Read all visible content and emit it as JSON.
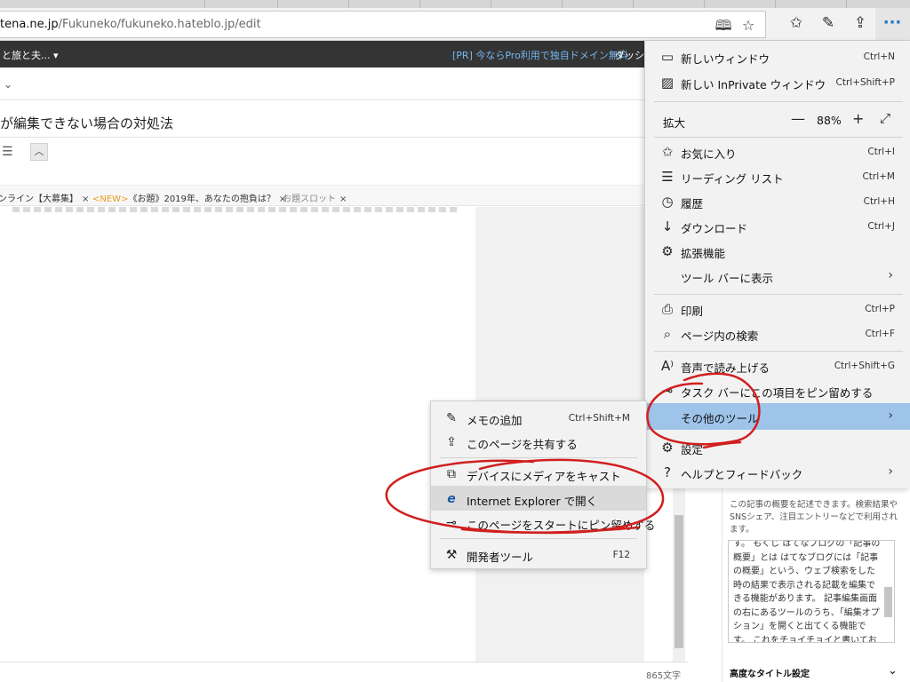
{
  "browser": {
    "url_prefix": "tena.ne.jp",
    "url_rest": "/Fukuneko/fukuneko.hateblo.jp/edit",
    "icons": [
      "reading-view-icon",
      "favorite-star-icon",
      "favorites-hub-icon",
      "pen-notes-icon",
      "share-icon",
      "more-dots-icon"
    ],
    "more_label": "···"
  },
  "page": {
    "blog_name": "と旅と夫... ▾",
    "pr_text": "[PR] 今ならPro利用で独自ドメイン無料",
    "dashboard": "ダッシュ",
    "title": "が編集できない場合の対処法",
    "tags": [
      {
        "prefix": "",
        "label": "ンライン【大募集】",
        "close": "×"
      },
      {
        "prefix": "<NEW>",
        "label": "《お題》2019年、あなたの抱負は？",
        "close": "×"
      },
      {
        "prefix": "",
        "label": "お題スロット",
        "close": "×"
      }
    ],
    "char_count": "865文字",
    "side_panel": {
      "description": "この記事の概要を記述できます。検索結果やSNSシェア、注目エントリーなどで利用されます。",
      "summary_text": "す。 もくじ はてなブログの「記事の概要」とは はてなブログには「記事の概要」という、ウェブ検索をした時の結果で表示される記載を編集できる機能があります。 記事編集画面の右にあるツールのうち、「編集オプション」を開くと出てくる機能です。 これをチョイチョイと書いてお",
      "advanced_label": "高度なタイトル設定"
    }
  },
  "menu": {
    "items_top": [
      {
        "icon": "new-window-icon",
        "label": "新しいウィンドウ",
        "shortcut": "Ctrl+N"
      },
      {
        "icon": "inprivate-window-icon",
        "label": "新しい InPrivate ウィンドウ",
        "shortcut": "Ctrl+Shift+P"
      }
    ],
    "zoom": {
      "label": "拡大",
      "value": "88%",
      "minus": "—",
      "plus": "+",
      "fullscreen": "⤢"
    },
    "items_mid": [
      {
        "icon": "favorites-icon",
        "label": "お気に入り",
        "shortcut": "Ctrl+I"
      },
      {
        "icon": "reading-list-icon",
        "label": "リーディング リスト",
        "shortcut": "Ctrl+M"
      },
      {
        "icon": "history-icon",
        "label": "履歴",
        "shortcut": "Ctrl+H"
      },
      {
        "icon": "download-icon",
        "label": "ダウンロード",
        "shortcut": "Ctrl+J"
      },
      {
        "icon": "extensions-icon",
        "label": "拡張機能",
        "shortcut": ""
      },
      {
        "icon": "",
        "label": "ツール バーに表示",
        "shortcut": "",
        "chevron": "›"
      }
    ],
    "items_print": [
      {
        "icon": "print-icon",
        "label": "印刷",
        "shortcut": "Ctrl+P"
      },
      {
        "icon": "find-icon",
        "label": "ページ内の検索",
        "shortcut": "Ctrl+F"
      }
    ],
    "items_tools": [
      {
        "icon": "read-aloud-icon",
        "label": "音声で読み上げる",
        "shortcut": "Ctrl+Shift+G"
      },
      {
        "icon": "pin-taskbar-icon",
        "label": "タスク バーにこの項目をピン留めする",
        "shortcut": ""
      },
      {
        "icon": "",
        "label": "その他のツール",
        "shortcut": "",
        "chevron": "›"
      },
      {
        "icon": "settings-gear-icon",
        "label": "設定",
        "shortcut": ""
      },
      {
        "icon": "help-question-icon",
        "label": "ヘルプとフィードバック",
        "shortcut": "",
        "chevron": "›"
      }
    ]
  },
  "submenu": {
    "items": [
      {
        "icon": "add-notes-icon",
        "label": "メモの追加",
        "shortcut": "Ctrl+Shift+M"
      },
      {
        "icon": "share-page-icon",
        "label": "このページを共有する",
        "shortcut": ""
      },
      {
        "icon": "cast-media-icon",
        "label": "デバイスにメディアをキャスト",
        "shortcut": ""
      },
      {
        "icon": "internet-explorer-icon",
        "label": "Internet Explorer で開く",
        "shortcut": ""
      },
      {
        "icon": "pin-start-icon",
        "label": "このページをスタートにピン留めする",
        "shortcut": ""
      },
      {
        "icon": "developer-tools-icon",
        "label": "開発者ツール",
        "shortcut": "F12"
      }
    ]
  },
  "colors": {
    "menu_bg": "#f2f2f2",
    "menu_highlight": "#9ec4ea",
    "hatena_bar": "#343434",
    "annotation_red": "#d11f1f",
    "link_blue": "#76b6f2"
  }
}
